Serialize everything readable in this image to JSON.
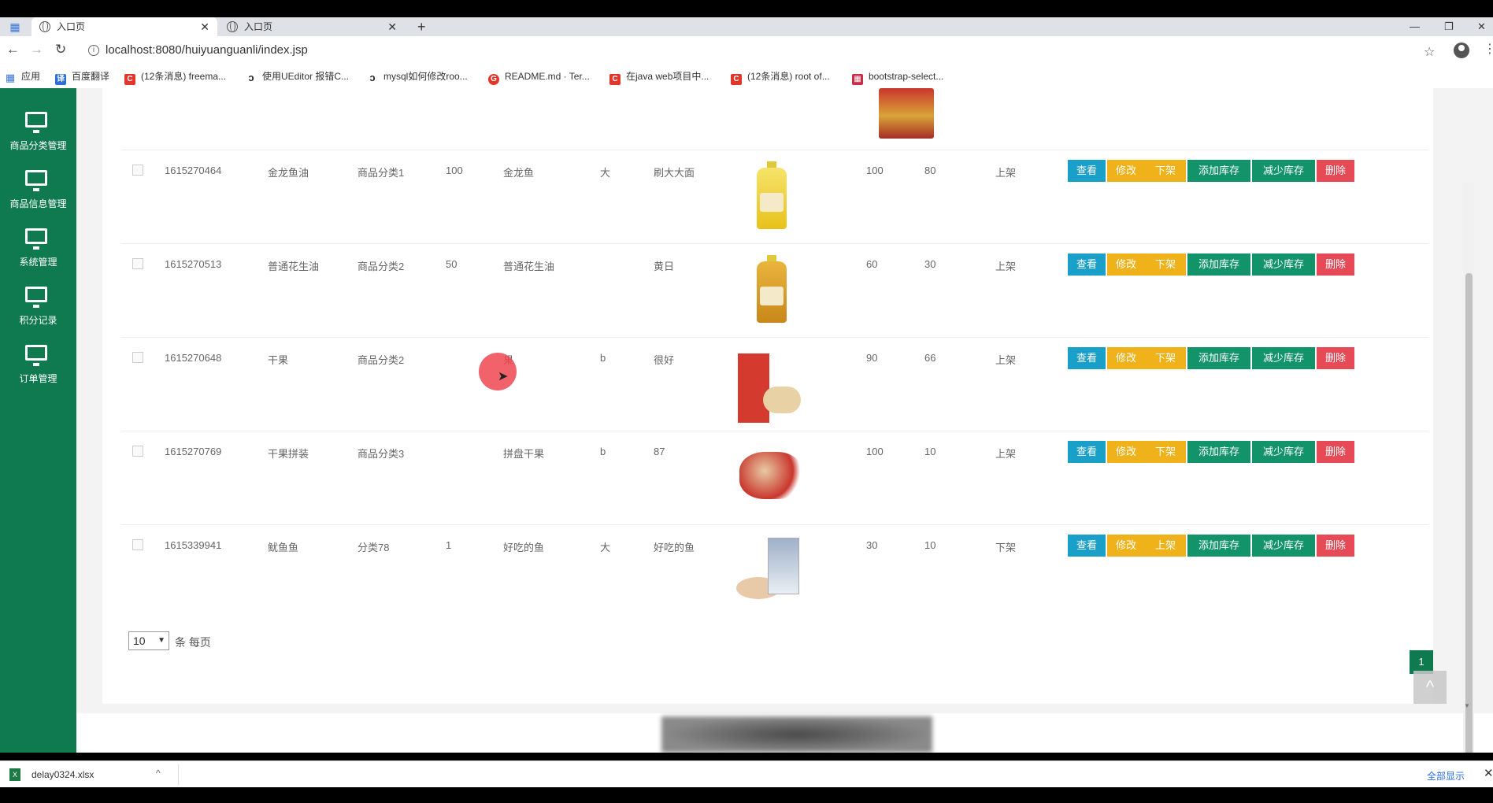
{
  "browser": {
    "tabs": [
      {
        "title": "入口页",
        "active": true
      },
      {
        "title": "入口页",
        "active": false
      }
    ],
    "url": "localhost:8080/huiyuanguanli/index.jsp",
    "bookmarks": [
      {
        "icon": "apps-grid-icon",
        "label": "应用"
      },
      {
        "icon": "translate-icon",
        "label": "百度翻译"
      },
      {
        "icon": "csdn-icon",
        "label": "(12条消息) freema..."
      },
      {
        "icon": "link-icon",
        "label": "使用UEditor 报错C..."
      },
      {
        "icon": "link-icon",
        "label": "mysql如何修改roo..."
      },
      {
        "icon": "gitee-icon",
        "label": "README.md · Ter..."
      },
      {
        "icon": "csdn-icon",
        "label": "在java web项目中..."
      },
      {
        "icon": "csdn-icon",
        "label": "(12条消息) root of..."
      },
      {
        "icon": "bookmark-icon",
        "label": "bootstrap-select..."
      }
    ]
  },
  "sidebar": {
    "items": [
      {
        "label": "商品分类管理"
      },
      {
        "label": "商品信息管理"
      },
      {
        "label": "系统管理"
      },
      {
        "label": "积分记录"
      },
      {
        "label": "订单管理"
      }
    ]
  },
  "buttons": {
    "view": "查看",
    "edit": "修改",
    "add_stock": "添加库存",
    "reduce_stock": "减少库存",
    "delete": "删除"
  },
  "rows": [
    {
      "id": "1615270464",
      "name": "金龙鱼油",
      "category": "商品分类1",
      "price": "100",
      "brand": "金龙鱼",
      "size": "大",
      "desc": "刷大大面",
      "stock": "100",
      "points": "80",
      "status": "上架",
      "toggle": "下架",
      "image": "oil-bottle-gold"
    },
    {
      "id": "1615270513",
      "name": "普通花生油",
      "category": "商品分类2",
      "price": "50",
      "brand": "普通花生油",
      "size": "",
      "desc": "黄日",
      "stock": "60",
      "points": "30",
      "status": "上架",
      "toggle": "下架",
      "image": "oil-bottle-amber"
    },
    {
      "id": "1615270648",
      "name": "干果",
      "category": "商品分类2",
      "price": "",
      "brand": "果",
      "size": "b",
      "desc": "很好",
      "stock": "90",
      "points": "66",
      "status": "上架",
      "toggle": "下架",
      "image": "dried-fruit-snack"
    },
    {
      "id": "1615270769",
      "name": "干果拼装",
      "category": "商品分类3",
      "price": "",
      "brand": "拼盘干果",
      "size": "b",
      "desc": "87",
      "stock": "100",
      "points": "10",
      "status": "上架",
      "toggle": "下架",
      "image": "nut-mix"
    },
    {
      "id": "1615339941",
      "name": "鱿鱼鱼",
      "category": "分类78",
      "price": "1",
      "brand": "好吃的鱼",
      "size": "大",
      "desc": "好吃的鱼",
      "stock": "30",
      "points": "10",
      "status": "下架",
      "toggle": "上架",
      "image": "fish-pack"
    }
  ],
  "pagination": {
    "page_size": "10",
    "per_page_label": "条 每页",
    "current_page": "1",
    "back_to_top": "^"
  },
  "downloads": {
    "file": "delay0324.xlsx",
    "show_all": "全部显示"
  }
}
